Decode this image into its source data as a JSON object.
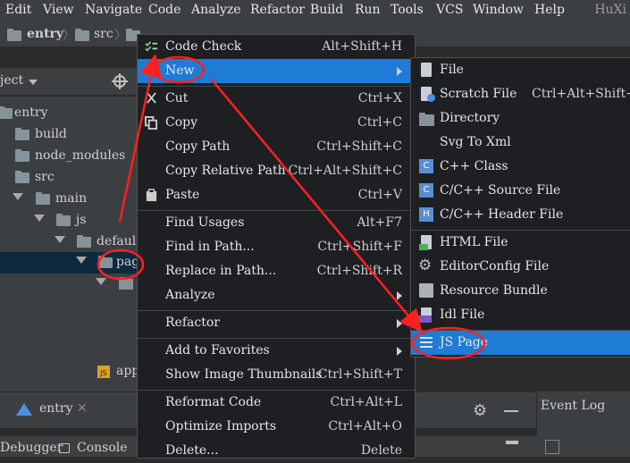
{
  "menubar": {
    "items": [
      "Edit",
      "View",
      "Navigate",
      "Code",
      "Analyze",
      "Refactor",
      "Build",
      "Run",
      "Tools",
      "VCS",
      "Window",
      "Help"
    ],
    "title": "HuXi"
  },
  "breadcrumb": {
    "items": [
      "entry",
      "src"
    ]
  },
  "project": {
    "header": "ject",
    "tree": [
      "entry",
      "build",
      "node_modules",
      "src",
      "main",
      "js",
      "default",
      "pag",
      "app"
    ]
  },
  "context_menu": {
    "items": [
      {
        "label": "Code Check",
        "shortcut": "Alt+Shift+H",
        "icon": "code-check-icon"
      },
      {
        "label": "New",
        "shortcut": "",
        "submenu": true,
        "highlighted": true
      },
      {
        "label": "Cut",
        "shortcut": "Ctrl+X",
        "icon": "cut-icon"
      },
      {
        "label": "Copy",
        "shortcut": "Ctrl+C",
        "icon": "copy-icon"
      },
      {
        "label": "Copy Path",
        "shortcut": "Ctrl+Shift+C"
      },
      {
        "label": "Copy Relative Path",
        "shortcut": "Ctrl+Alt+Shift+C"
      },
      {
        "label": "Paste",
        "shortcut": "Ctrl+V",
        "icon": "paste-icon"
      },
      {
        "label": "Find Usages",
        "shortcut": "Alt+F7"
      },
      {
        "label": "Find in Path...",
        "shortcut": "Ctrl+Shift+F"
      },
      {
        "label": "Replace in Path...",
        "shortcut": "Ctrl+Shift+R"
      },
      {
        "label": "Analyze",
        "shortcut": "",
        "submenu": true
      },
      {
        "label": "Refactor",
        "shortcut": "",
        "submenu": true
      },
      {
        "label": "Add to Favorites",
        "shortcut": "",
        "submenu": true
      },
      {
        "label": "Show Image Thumbnails",
        "shortcut": "Ctrl+Shift+T"
      },
      {
        "label": "Reformat Code",
        "shortcut": "Ctrl+Alt+L"
      },
      {
        "label": "Optimize Imports",
        "shortcut": "Ctrl+Alt+O"
      },
      {
        "label": "Delete...",
        "shortcut": "Delete"
      }
    ]
  },
  "new_submenu": {
    "items": [
      {
        "label": "File",
        "shortcut": ""
      },
      {
        "label": "Scratch File",
        "shortcut": "Ctrl+Alt+Shift+Ins"
      },
      {
        "label": "Directory",
        "shortcut": ""
      },
      {
        "label": "Svg To Xml",
        "shortcut": ""
      },
      {
        "label": "C++ Class",
        "shortcut": ""
      },
      {
        "label": "C/C++ Source File",
        "shortcut": ""
      },
      {
        "label": "C/C++ Header File",
        "shortcut": ""
      },
      {
        "label": "HTML File",
        "shortcut": ""
      },
      {
        "label": "EditorConfig File",
        "shortcut": ""
      },
      {
        "label": "Resource Bundle",
        "shortcut": ""
      },
      {
        "label": "Idl File",
        "shortcut": ""
      },
      {
        "label": "JS Page",
        "shortcut": "",
        "highlighted": true
      }
    ]
  },
  "bottom": {
    "tab_entry": "entry",
    "event_log": "Event Log",
    "debugger": "Debugger",
    "console": "Console"
  },
  "colors": {
    "highlight": "#1e7bd6",
    "annotation": "#ff2020"
  }
}
